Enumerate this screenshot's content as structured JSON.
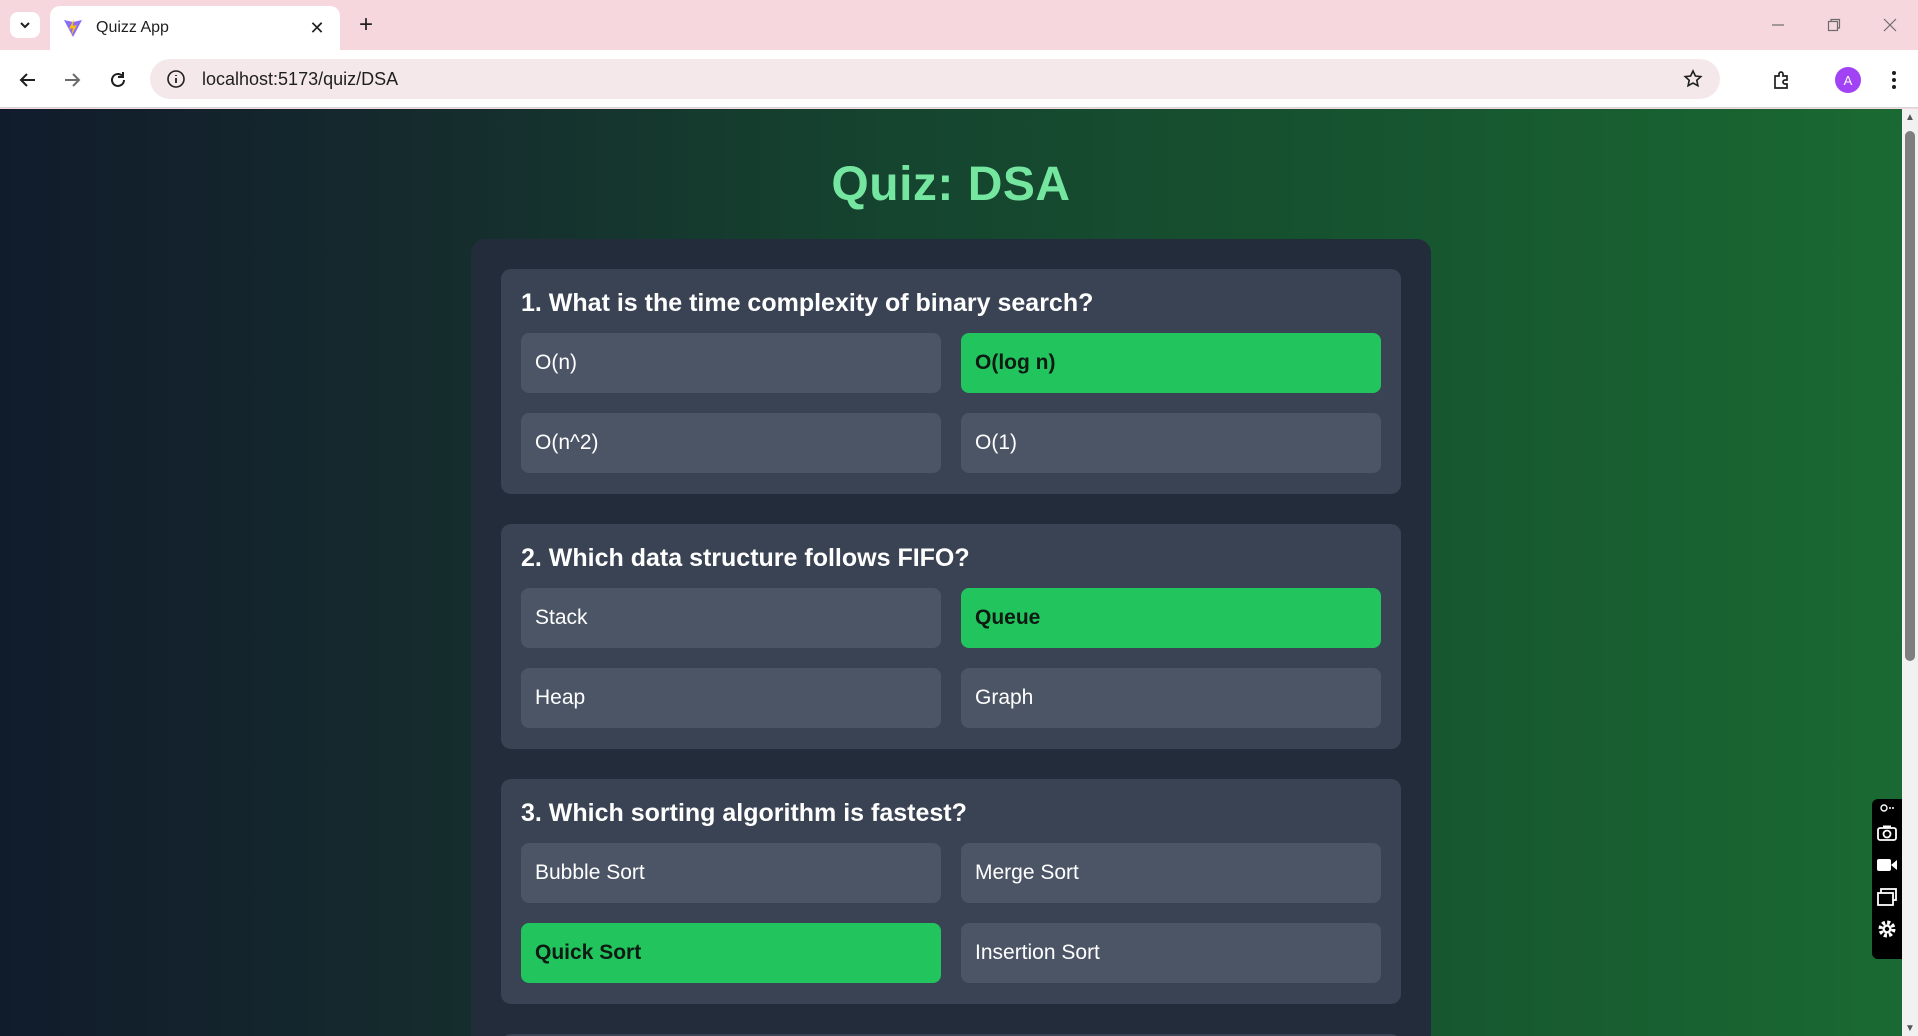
{
  "browser": {
    "tab_title": "Quizz App",
    "url": "localhost:5173/quiz/DSA",
    "profile_initial": "A",
    "new_tab_label": "+",
    "tab_close_label": "✕"
  },
  "page": {
    "title": "Quiz: DSA"
  },
  "questions": [
    {
      "text": "1. What is the time complexity of binary search?",
      "options": [
        "O(n)",
        "O(log n)",
        "O(n^2)",
        "O(1)"
      ],
      "selected": "O(log n)"
    },
    {
      "text": "2. Which data structure follows FIFO?",
      "options": [
        "Stack",
        "Queue",
        "Heap",
        "Graph"
      ],
      "selected": "Queue"
    },
    {
      "text": "3. Which sorting algorithm is fastest?",
      "options": [
        "Bubble Sort",
        "Merge Sort",
        "Quick Sort",
        "Insertion Sort"
      ],
      "selected": "Quick Sort"
    }
  ],
  "colors": {
    "title_green": "#75e6a0",
    "correct_green": "#22c45e",
    "option_gray": "#4c5566",
    "card_bg": "#3a4353",
    "panel_bg": "#222c3b"
  }
}
